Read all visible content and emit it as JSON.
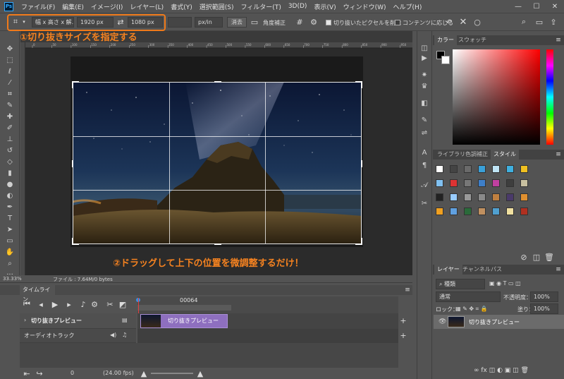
{
  "app": {
    "logo": "Ps"
  },
  "menu": [
    "ファイル(F)",
    "編集(E)",
    "イメージ(I)",
    "レイヤー(L)",
    "書式(Y)",
    "選択範囲(S)",
    "フィルター(T)",
    "3D(D)",
    "表示(V)",
    "ウィンドウ(W)",
    "ヘルプ(H)"
  ],
  "options": {
    "ratio_preset": "幅 x 高さ x 解...",
    "width_value": "1920 px",
    "height_value": "1080 px",
    "resolution_unit": "px/in",
    "clear_label": "消去",
    "straighten_label": "角度補正",
    "delete_cropped_label": "切り抜いたピクセルを削除",
    "delete_cropped_checked": true,
    "content_aware_label": "コンテンツに応じる",
    "content_aware_checked": false
  },
  "callouts": {
    "step1": "①切り抜きサイズを指定する",
    "step2": "②ドラッグして上下の位置を微調整するだけ！"
  },
  "ruler_ticks": [
    "0",
    "50",
    "100",
    "150",
    "200",
    "250",
    "300",
    "350",
    "400",
    "450",
    "500",
    "550",
    "600",
    "650",
    "700",
    "750",
    "800",
    "850",
    "900",
    "950"
  ],
  "status": {
    "zoom": "33.33%",
    "file_info": "ファイル : 7.64M/0 bytes"
  },
  "timeline": {
    "tab_label": "タイムライン",
    "timecode": "00064",
    "video_track_label": "切り抜きプレビュー",
    "audio_track_label": "オーディオトラック",
    "clip_label": "切り抜きプレビュー",
    "frame_value": "0",
    "fps_label": "(24.00 fps)"
  },
  "right_panel": {
    "color_tabs": [
      "カラー",
      "スウォッチ"
    ],
    "library_tabs": [
      "ライブラリ",
      "色調補正",
      "スタイル"
    ],
    "active_library_tab": "スタイル",
    "style_swatches": [
      "#fff",
      "#444",
      "#6a6a6a",
      "#3aa0d8",
      "#bfe4f5",
      "#3fb0e0",
      "#f0c020",
      "#80c0f0",
      "#d33",
      "#777",
      "#3e7fc8",
      "#c040a0",
      "#3e3e3e",
      "#c8c0a0",
      "#222",
      "#9cf",
      "#999",
      "#8a8a8a",
      "#c08040",
      "#4a3a6a",
      "#e09030",
      "#f0a020",
      "#60a0e0",
      "#2a6a3a",
      "#c09060",
      "#50a0d0",
      "#f0e0a0",
      "#b03020"
    ],
    "layer_tabs": [
      "レイヤー",
      "チャンネル",
      "パス"
    ],
    "layer_search": "種類",
    "blend_mode": "通常",
    "opacity_label": "不透明度：",
    "opacity_value": "100%",
    "lock_label": "ロック：",
    "fill_label": "塗り：",
    "fill_value": "100%",
    "layer_name": "切り抜きプレビュー"
  }
}
